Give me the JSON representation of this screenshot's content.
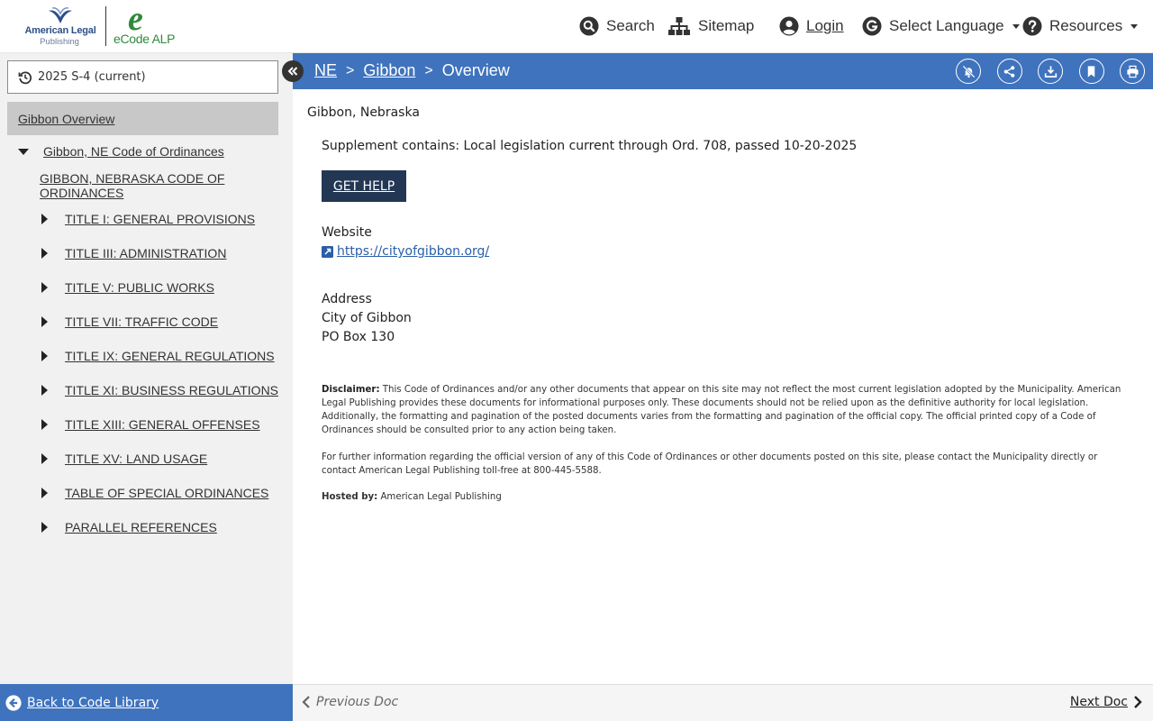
{
  "header": {
    "logo_publisher_line1": "American Legal",
    "logo_publisher_line2": "Publishing",
    "logo_product_letter": "e",
    "logo_product_name": "eCode",
    "logo_product_suffix": "ALP",
    "nav": {
      "search": "Search",
      "sitemap": "Sitemap",
      "login": "Login",
      "language": "Select Language",
      "resources": "Resources"
    }
  },
  "sidebar": {
    "version": "2025 S-4 (current)",
    "overview": "Gibbon Overview",
    "code_title": "Gibbon, NE Code of Ordinances",
    "code_heading": "GIBBON, NEBRASKA CODE OF ORDINANCES",
    "titles": [
      "TITLE I: GENERAL PROVISIONS",
      "TITLE III: ADMINISTRATION",
      "TITLE V: PUBLIC WORKS",
      "TITLE VII: TRAFFIC CODE",
      "TITLE IX: GENERAL REGULATIONS",
      "TITLE XI: BUSINESS REGULATIONS",
      "TITLE XIII: GENERAL OFFENSES",
      "TITLE XV: LAND USAGE",
      "TABLE OF SPECIAL ORDINANCES",
      "PARALLEL REFERENCES"
    ],
    "back_label": "Back to Code Library"
  },
  "breadcrumb": {
    "state": "NE",
    "city": "Gibbon",
    "current": "Overview",
    "separator": ">"
  },
  "content": {
    "place": "Gibbon, Nebraska",
    "supplement": "Supplement contains: Local legislation current through Ord. 708, passed 10-20-2025",
    "help_button": "GET HELP",
    "website_heading": "Website",
    "website_url": "https://cityofgibbon.org/",
    "address_heading": "Address",
    "address_line1": "City of Gibbon",
    "address_line2": "PO Box 130",
    "disclaimer_label": "Disclaimer:",
    "disclaimer_text": " This Code of Ordinances and/or any other documents that appear on this site may not reflect the most current legislation adopted by the Municipality. American Legal Publishing provides these documents for informational purposes only. These documents should not be relied upon as the definitive authority for local legislation. Additionally, the formatting and pagination of the posted documents varies from the formatting and pagination of the official copy. The official printed copy of a Code of Ordinances should be consulted prior to any action being taken.",
    "further_info": "For further information regarding the official version of any of this Code of Ordinances or other documents posted on this site, please contact the Municipality directly or contact American Legal Publishing toll-free at 800-445-5588.",
    "hosted_label": "Hosted by:",
    "hosted_value": " American Legal Publishing"
  },
  "footer": {
    "prev": "Previous Doc",
    "next": "Next Doc"
  },
  "colors": {
    "brand_blue": "#3f73bd",
    "help_button": "#233754",
    "sidebar_bg": "#f1f1f1",
    "logo_green": "#2f8a3a"
  },
  "icons": {
    "search": "search-icon",
    "sitemap": "sitemap-icon",
    "login": "user-circle-icon",
    "language": "google-icon",
    "resources": "question-circle-icon",
    "version": "history-icon",
    "collapse": "double-chevron-left-icon",
    "tools": [
      "notification-off-icon",
      "share-icon",
      "download-icon",
      "bookmark-icon",
      "print-icon"
    ]
  }
}
